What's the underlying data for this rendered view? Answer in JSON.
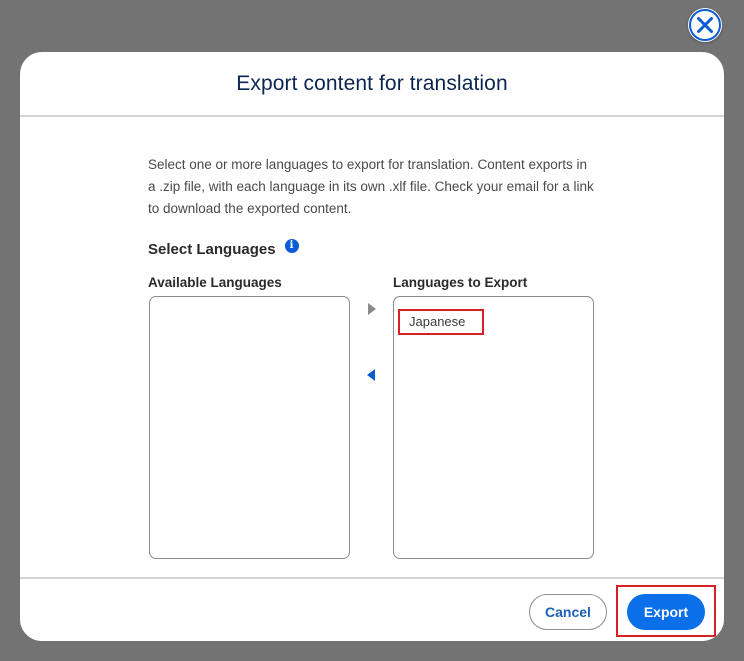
{
  "dialog": {
    "title": "Export content for translation",
    "description": "Select one or more languages to export for translation. Content exports in a .zip file, with each language in its own .xlf file. Check your email for a link to download the exported content.",
    "section_label": "Select Languages",
    "info_icon_glyph": "i",
    "available_label": "Available Languages",
    "available_items": [],
    "export_label": "Languages to Export",
    "export_items": [
      "Japanese"
    ]
  },
  "footer": {
    "cancel_label": "Cancel",
    "export_label": "Export"
  },
  "icons": {
    "close": "close-icon",
    "move_right": "arrow-right-icon",
    "move_left": "arrow-left-icon",
    "info": "info-icon"
  },
  "colors": {
    "accent": "#0b6fea",
    "title": "#0b2550",
    "highlight": "#d62027",
    "move_right_arrow": "#8a8a8a",
    "move_left_arrow": "#0b5cd5"
  }
}
